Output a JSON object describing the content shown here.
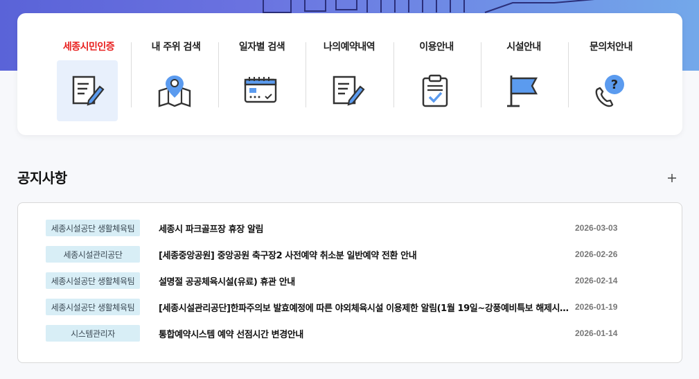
{
  "quick_menu": {
    "items": [
      {
        "label": "세종시민인증",
        "icon": "edit-document-icon",
        "active": true
      },
      {
        "label": "내 주위 검색",
        "icon": "map-pin-icon",
        "active": false
      },
      {
        "label": "일자별 검색",
        "icon": "calendar-icon",
        "active": false
      },
      {
        "label": "나의예약내역",
        "icon": "edit-document-icon",
        "active": false
      },
      {
        "label": "이용안내",
        "icon": "clipboard-check-icon",
        "active": false
      },
      {
        "label": "시설안내",
        "icon": "flag-icon",
        "active": false
      },
      {
        "label": "문의처안내",
        "icon": "phone-question-icon",
        "active": false
      }
    ]
  },
  "notice": {
    "title": "공지사항",
    "more_icon": "plus-icon",
    "rows": [
      {
        "badge": "세종시설공단 생활체육팀",
        "title": "세종시 파크골프장 휴장 알림",
        "date": "2026-03-03"
      },
      {
        "badge": "세종시설관리공단",
        "title": "[세종중앙공원] 중앙공원 축구장2 사전예약 취소분 일반예약 전환 안내",
        "date": "2026-02-26"
      },
      {
        "badge": "세종시설공단 생활체육팀",
        "title": "설명절 공공체육시설(유료) 휴관 안내",
        "date": "2026-02-14"
      },
      {
        "badge": "세종시설공단 생활체육팀",
        "title": "[세종시설관리공단]한파주의보 발효예정에 따른 야외체육시설 이용제한 알림(1월 19일~강풍예비특보 해제시까지)",
        "date": "2026-01-19"
      },
      {
        "badge": "시스템관리자",
        "title": "통합예약시스템 예약 선점시간 변경안내",
        "date": "2026-01-14"
      }
    ]
  },
  "colors": {
    "accent_red": "#e8201f",
    "icon_blue": "#5b9bef",
    "badge_bg": "#d8eef6"
  }
}
